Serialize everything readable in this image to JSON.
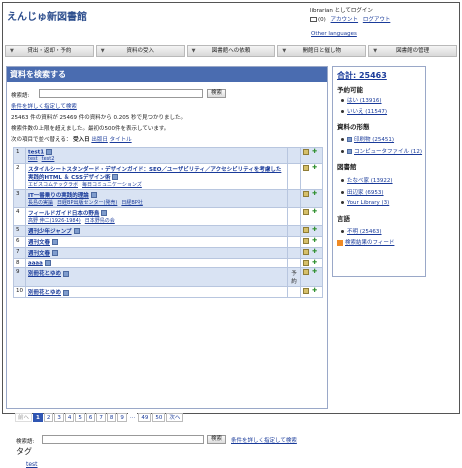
{
  "header": {
    "site_title": "えんじゅ新図書館",
    "login_status": "librarian としてログイン",
    "messages": "(0)",
    "account": "アカウント",
    "logout": "ログアウト",
    "other_languages": "Other languages"
  },
  "nav": [
    "貸出・返却・予約",
    "資料の受入",
    "図書館への依頼",
    "開館日と催し物",
    "図書館の管理"
  ],
  "main": {
    "title": "資料を検索する",
    "search_label": "検索語:",
    "search_value": "",
    "search_button": "検索",
    "advanced_link": "条件を詳しく指定して検索",
    "result_line1": "25463 件の資料が 25469 件の資料から 0.205 秒で見つかりました。",
    "result_line2": "検索件数の上限を超えました。最初の500件を表示しています。",
    "sort_prefix": "次の項目で並べ替える：",
    "sort_asc": "受入日",
    "sort_date": "出版日",
    "sort_title": "タイトル"
  },
  "results": [
    {
      "num": "1",
      "title": "test1",
      "subs": [
        "test",
        "test2"
      ],
      "mid": ""
    },
    {
      "num": "2",
      "title": "スタイルシートスタンダード・デザインガイド：SEO／ユーザビリティ／アクセシビリティを考慮した実践的HTML ＆ CSSデザイン術",
      "subs": [
        "エビスコムテックラボ",
        "毎日コミュニケーションズ"
      ],
      "mid": ""
    },
    {
      "num": "3",
      "title": "IT一番乗りの実践的理論",
      "subs": [
        "長島の実論",
        "日経BP出版センター(発売)",
        "日経BP社"
      ],
      "mid": ""
    },
    {
      "num": "4",
      "title": "フィールドガイド日本の野鳥",
      "subs": [
        "高野 伸二(1926-1984)",
        "日本野鳥の会"
      ],
      "mid": ""
    },
    {
      "num": "5",
      "title": "週刊少年ジャンプ",
      "subs": [],
      "mid": ""
    },
    {
      "num": "6",
      "title": "週刊文春",
      "subs": [],
      "mid": ""
    },
    {
      "num": "7",
      "title": "週刊文春",
      "subs": [],
      "mid": ""
    },
    {
      "num": "8",
      "title": "aaaa",
      "subs": [],
      "mid": ""
    },
    {
      "num": "9",
      "title": "別冊花とゆめ",
      "subs": [],
      "mid": "予約"
    },
    {
      "num": "10",
      "title": "別冊花とゆめ",
      "subs": [],
      "mid": ""
    }
  ],
  "pager": {
    "prev": "前へ",
    "pages": [
      "1",
      "2",
      "3",
      "4",
      "5",
      "6",
      "7",
      "8",
      "9"
    ],
    "ellipsis": "…",
    "last_pages": [
      "49",
      "50"
    ],
    "next": "次へ",
    "current": "1"
  },
  "bottom": {
    "search_label": "検索語:",
    "search_button": "検索",
    "advanced_link": "条件を詳しく指定して検索",
    "tag_heading": "タグ",
    "tag_item": "test"
  },
  "sidebar": {
    "total": "合計: 25463",
    "reservable_heading": "予約可能",
    "reservable": [
      {
        "label": "はい (13916)"
      },
      {
        "label": "いいえ (11547)"
      }
    ],
    "carrier_heading": "資料の形態",
    "carrier": [
      {
        "label": "印刷物 (25451)"
      },
      {
        "label": "コンピュータファイル (12)"
      }
    ],
    "library_heading": "図書館",
    "libraries": [
      {
        "label": "たなべ家 (13922)"
      },
      {
        "label": "田辺家 (6953)"
      },
      {
        "label": "Your Library (3)"
      }
    ],
    "language_heading": "言語",
    "languages": [
      {
        "label": "不明 (25463)"
      }
    ],
    "feed_link": "検索結果のフィード"
  }
}
